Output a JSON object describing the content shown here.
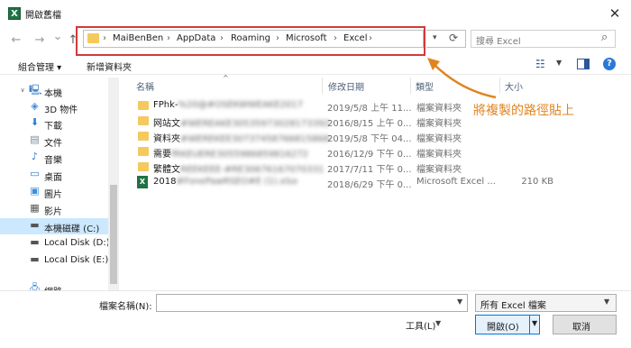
{
  "window": {
    "title": "開啟舊檔",
    "app_icon_letter": "X",
    "close_glyph": "✕"
  },
  "nav": {
    "back_glyph": "←",
    "forward_glyph": "→",
    "dropdown_glyph": "⌄",
    "up_glyph": "↑",
    "breadcrumb": [
      "MaiBenBen",
      "AppData",
      "Roaming",
      "Microsoft",
      "Excel"
    ],
    "separator": "›",
    "search_placeholder": "搜尋 Excel"
  },
  "toolbar": {
    "organize_label": "組合管理 ▾",
    "new_folder_label": "新增資料夾"
  },
  "sidebar": {
    "items": [
      {
        "label": "本機",
        "icon": "computer-icon"
      },
      {
        "label": "3D 物件",
        "icon": "cube-icon"
      },
      {
        "label": "下載",
        "icon": "download-icon"
      },
      {
        "label": "文件",
        "icon": "document-icon"
      },
      {
        "label": "音樂",
        "icon": "music-icon"
      },
      {
        "label": "桌面",
        "icon": "desktop-icon"
      },
      {
        "label": "圖片",
        "icon": "pictures-icon"
      },
      {
        "label": "影片",
        "icon": "video-icon"
      },
      {
        "label": "本機磁碟 (C:)",
        "icon": "drive-c-icon"
      },
      {
        "label": "Local Disk (D:)",
        "icon": "drive-icon"
      },
      {
        "label": "Local Disk (E:)",
        "icon": "drive-icon"
      },
      {
        "label": "網路",
        "icon": "network-icon"
      }
    ]
  },
  "columns": {
    "name": "名稱",
    "date": "修改日期",
    "type": "類型",
    "size": "大小"
  },
  "files": [
    {
      "name": "FPhk-",
      "name_hidden": "%20@#OSEKWWEAKE2017",
      "date": "2019/5/8 上午 11...",
      "type": "檔案資料夾",
      "size": "",
      "kind": "folder"
    },
    {
      "name": "网站文",
      "name_hidden": "#WEREAKE30535973028173392",
      "date": "2016/8/15 上午 0...",
      "type": "檔案資料夾",
      "size": "",
      "kind": "folder"
    },
    {
      "name": "資料夾",
      "name_hidden": "#WEREKEE30737458766815868",
      "date": "2019/5/8 下午 04...",
      "type": "檔案資料夾",
      "size": "",
      "kind": "folder"
    },
    {
      "name": "需要",
      "name_hidden": "fRKEUERE3055986859816272",
      "date": "2016/12/9 下午 0...",
      "type": "檔案資料夾",
      "size": "",
      "kind": "folder"
    },
    {
      "name": "繁體文",
      "name_hidden": "REEKEEE-#RE30676167070331",
      "date": "2017/7/11 下午 0...",
      "type": "檔案資料夾",
      "size": "",
      "kind": "folder"
    },
    {
      "name": "2018",
      "name_hidden": "#FonePawRSEO#E (1).xlsx",
      "date": "2018/6/29 下午 0...",
      "type": "Microsoft Excel ...",
      "size": "210 KB",
      "kind": "excel"
    }
  ],
  "annotation": {
    "text": "將複製的路徑貼上",
    "color": "#e08420"
  },
  "bottom": {
    "filename_label": "檔案名稱(N):",
    "filename_value": "",
    "filter_value": "所有 Excel 檔案",
    "tools_label": "工具(L)",
    "open_label": "開啟(O)",
    "cancel_label": "取消"
  },
  "colors": {
    "highlight_box": "#d23a3a",
    "selected_sidebar": "#cce8ff",
    "accent": "#0078d7"
  }
}
